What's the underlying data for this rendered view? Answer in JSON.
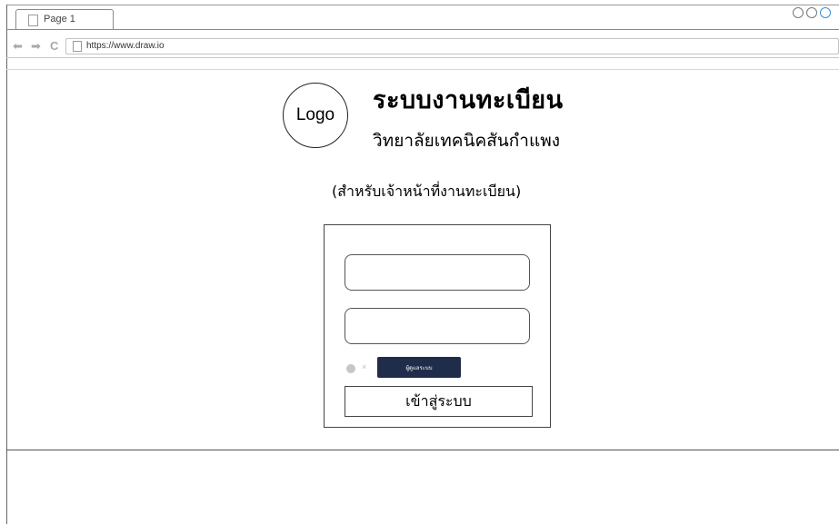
{
  "browser": {
    "tab_label": "Page 1",
    "url": "https://www.draw.io",
    "icons": [
      "back-arrow-icon",
      "forward-arrow-icon",
      "refresh-icon",
      "page-icon"
    ]
  },
  "header": {
    "logo_text": "Logo",
    "title": "ระบบงานทะเบียน",
    "subtitle": "วิทยาลัยเทคนิคสันกำแพง",
    "note": "(สำหรับเจ้าหน้าที่งานทะเบียน)"
  },
  "login": {
    "username_value": "",
    "password_value": "",
    "toggle_mark": "×",
    "role_button_label": "ผู้ดูแลระบบ",
    "submit_label": "เข้าสู่ระบบ"
  },
  "colors": {
    "role_button_bg": "#1f2d4a",
    "border": "#444444"
  }
}
